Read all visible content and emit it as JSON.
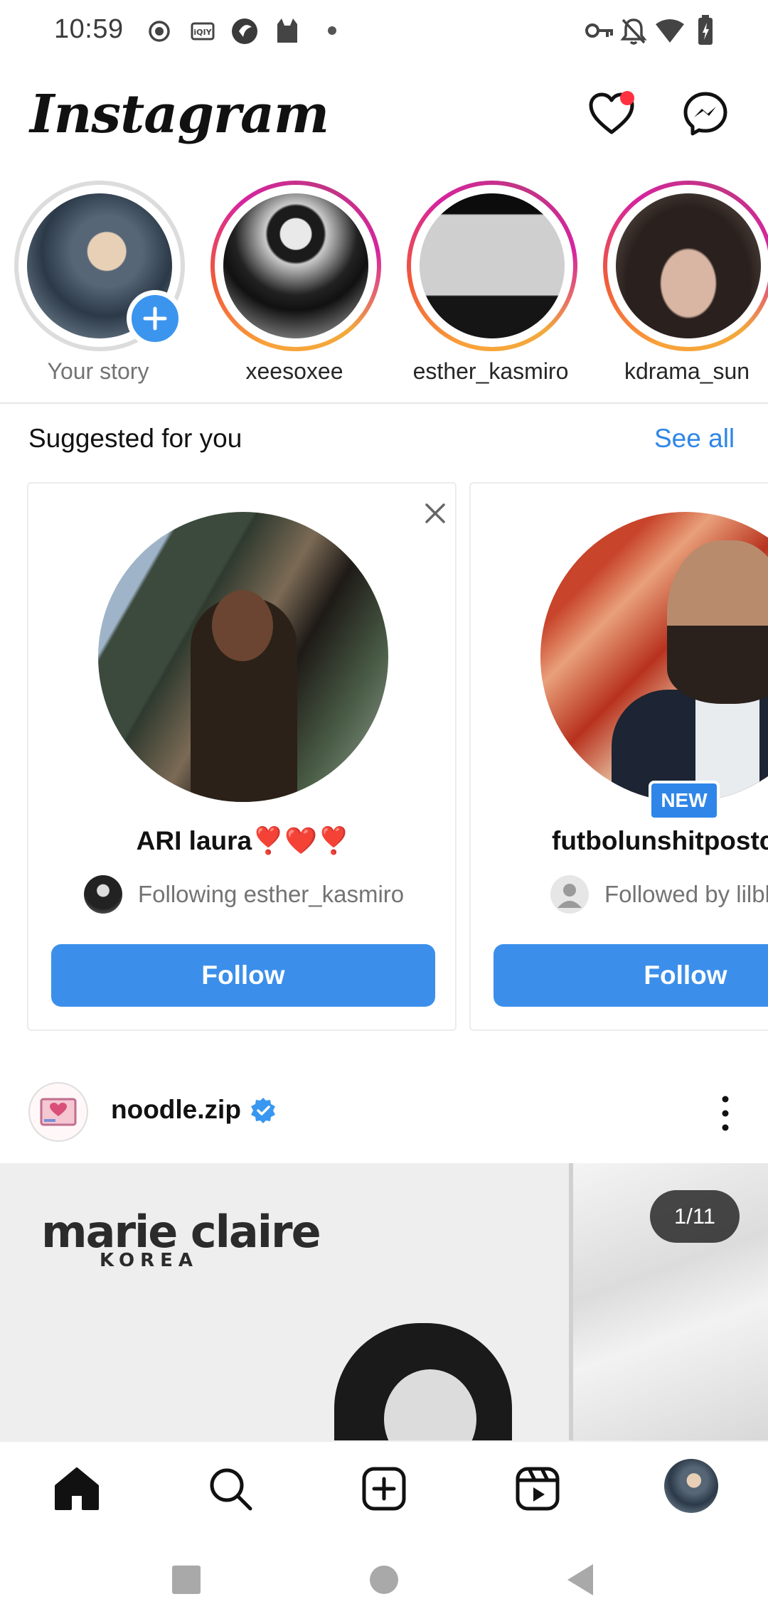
{
  "status_bar": {
    "time": "10:59",
    "left_icons": [
      "record-icon",
      "iqiyi-icon",
      "app-icon",
      "cat-icon",
      "dot-icon"
    ],
    "right_icons": [
      "key-icon",
      "notifications-off-icon",
      "wifi-icon",
      "battery-charging-icon"
    ]
  },
  "header": {
    "logo": "Instagram",
    "notification_dot": true,
    "icons": [
      "heart-icon",
      "messenger-icon"
    ]
  },
  "stories": [
    {
      "label": "Your story",
      "own": true
    },
    {
      "label": "xeesoxee"
    },
    {
      "label": "esther_kasmiro"
    },
    {
      "label": "kdrama_sun"
    }
  ],
  "suggested": {
    "title": "Suggested for you",
    "see_all": "See all",
    "cards": [
      {
        "name": "ARI  laura❣️❤️❣️",
        "subtitle": "Following esther_kasmiro",
        "follow": "Follow"
      },
      {
        "name": "futbolunshitpostc",
        "subtitle": "Followed by lilbl",
        "follow": "Follow",
        "badge": "NEW"
      }
    ]
  },
  "post": {
    "username": "noodle.zip",
    "verified": true,
    "counter": "1/11",
    "brand": "marie claire",
    "brand_sub": "KOREA"
  },
  "bottom_nav": {
    "items": [
      "home-icon",
      "search-icon",
      "create-icon",
      "reels-icon",
      "profile-avatar"
    ],
    "active": "home"
  },
  "system_nav": [
    "recents-button",
    "home-button",
    "back-button"
  ],
  "colors": {
    "accent_blue": "#3b8fea",
    "link_blue": "#2f86e8",
    "notification_red": "#ff3040"
  }
}
